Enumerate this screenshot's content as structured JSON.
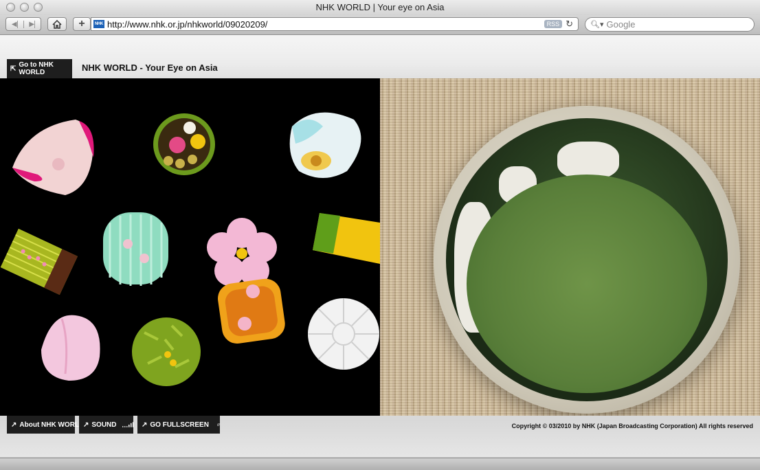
{
  "window": {
    "title": "NHK WORLD | Your eye on Asia"
  },
  "toolbar": {
    "url": "http://www.nhk.or.jp/nhkworld/09020209/",
    "rss_label": "RSS",
    "search_placeholder": "Google",
    "favicon_text": "NHK"
  },
  "header": {
    "goto_label": "Go to NHK WORLD",
    "site_title": "NHK WORLD - Your Eye on Asia"
  },
  "footer": {
    "about_label": "About NHK WORLD",
    "sound_label": "SOUND",
    "fullscreen_label": "GO FULLSCREEN",
    "copyright": "Copyright © 03/2010 by NHK (Japan Broadcasting Corporation) All rights reserved"
  },
  "icons": {
    "back": "arrow-left-icon",
    "forward": "arrow-right-icon",
    "home": "home-icon",
    "add": "plus-icon",
    "reload": "reload-icon",
    "search": "magnifier-icon",
    "external": "external-arrow-icon",
    "sound": "sound-level-icon",
    "fullscreen": "fullscreen-icon"
  }
}
